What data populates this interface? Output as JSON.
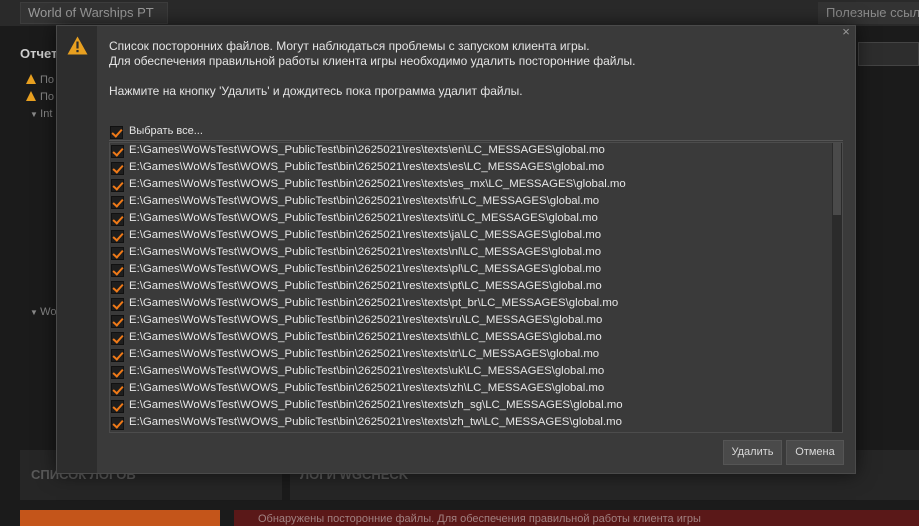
{
  "background": {
    "region_select": "World of Warships PT",
    "useful_links": "Полезные ссыл",
    "reports_title": "Отчет",
    "report_rows": [
      "По",
      "По",
      "Int"
    ],
    "wc_row": "Wo",
    "panel_logs": "СПИСОК ЛОГОВ",
    "panel_wgcheck": "ЛОГИ WGCHECK",
    "footer_warning": "Обнаружены посторонние файлы. Для обеспечения правильной работы клиента игры"
  },
  "dialog": {
    "icon": "warning-icon",
    "close_label": "×",
    "message_line1": "Список посторонних файлов. Могут наблюдаться проблемы с запуском клиента игры.",
    "message_line2": "Для обеспечения правильной работы клиента игры необходимо удалить посторонние файлы.",
    "message_line3": "Нажмите на кнопку 'Удалить' и дождитесь пока программа удалит файлы.",
    "select_all_label": "Выбрать все...",
    "files": [
      "E:\\Games\\WoWsTest\\WOWS_PublicTest\\bin\\2625021\\res\\texts\\en\\LC_MESSAGES\\global.mo",
      "E:\\Games\\WoWsTest\\WOWS_PublicTest\\bin\\2625021\\res\\texts\\es\\LC_MESSAGES\\global.mo",
      "E:\\Games\\WoWsTest\\WOWS_PublicTest\\bin\\2625021\\res\\texts\\es_mx\\LC_MESSAGES\\global.mo",
      "E:\\Games\\WoWsTest\\WOWS_PublicTest\\bin\\2625021\\res\\texts\\fr\\LC_MESSAGES\\global.mo",
      "E:\\Games\\WoWsTest\\WOWS_PublicTest\\bin\\2625021\\res\\texts\\it\\LC_MESSAGES\\global.mo",
      "E:\\Games\\WoWsTest\\WOWS_PublicTest\\bin\\2625021\\res\\texts\\ja\\LC_MESSAGES\\global.mo",
      "E:\\Games\\WoWsTest\\WOWS_PublicTest\\bin\\2625021\\res\\texts\\nl\\LC_MESSAGES\\global.mo",
      "E:\\Games\\WoWsTest\\WOWS_PublicTest\\bin\\2625021\\res\\texts\\pl\\LC_MESSAGES\\global.mo",
      "E:\\Games\\WoWsTest\\WOWS_PublicTest\\bin\\2625021\\res\\texts\\pt\\LC_MESSAGES\\global.mo",
      "E:\\Games\\WoWsTest\\WOWS_PublicTest\\bin\\2625021\\res\\texts\\pt_br\\LC_MESSAGES\\global.mo",
      "E:\\Games\\WoWsTest\\WOWS_PublicTest\\bin\\2625021\\res\\texts\\ru\\LC_MESSAGES\\global.mo",
      "E:\\Games\\WoWsTest\\WOWS_PublicTest\\bin\\2625021\\res\\texts\\th\\LC_MESSAGES\\global.mo",
      "E:\\Games\\WoWsTest\\WOWS_PublicTest\\bin\\2625021\\res\\texts\\tr\\LC_MESSAGES\\global.mo",
      "E:\\Games\\WoWsTest\\WOWS_PublicTest\\bin\\2625021\\res\\texts\\uk\\LC_MESSAGES\\global.mo",
      "E:\\Games\\WoWsTest\\WOWS_PublicTest\\bin\\2625021\\res\\texts\\zh\\LC_MESSAGES\\global.mo",
      "E:\\Games\\WoWsTest\\WOWS_PublicTest\\bin\\2625021\\res\\texts\\zh_sg\\LC_MESSAGES\\global.mo",
      "E:\\Games\\WoWsTest\\WOWS_PublicTest\\bin\\2625021\\res\\texts\\zh_tw\\LC_MESSAGES\\global.mo"
    ],
    "delete_label": "Удалить",
    "cancel_label": "Отмена"
  },
  "colors": {
    "accent": "#f07a18",
    "warning": "#e8a020",
    "dialog_bg": "#3a3a3a"
  }
}
